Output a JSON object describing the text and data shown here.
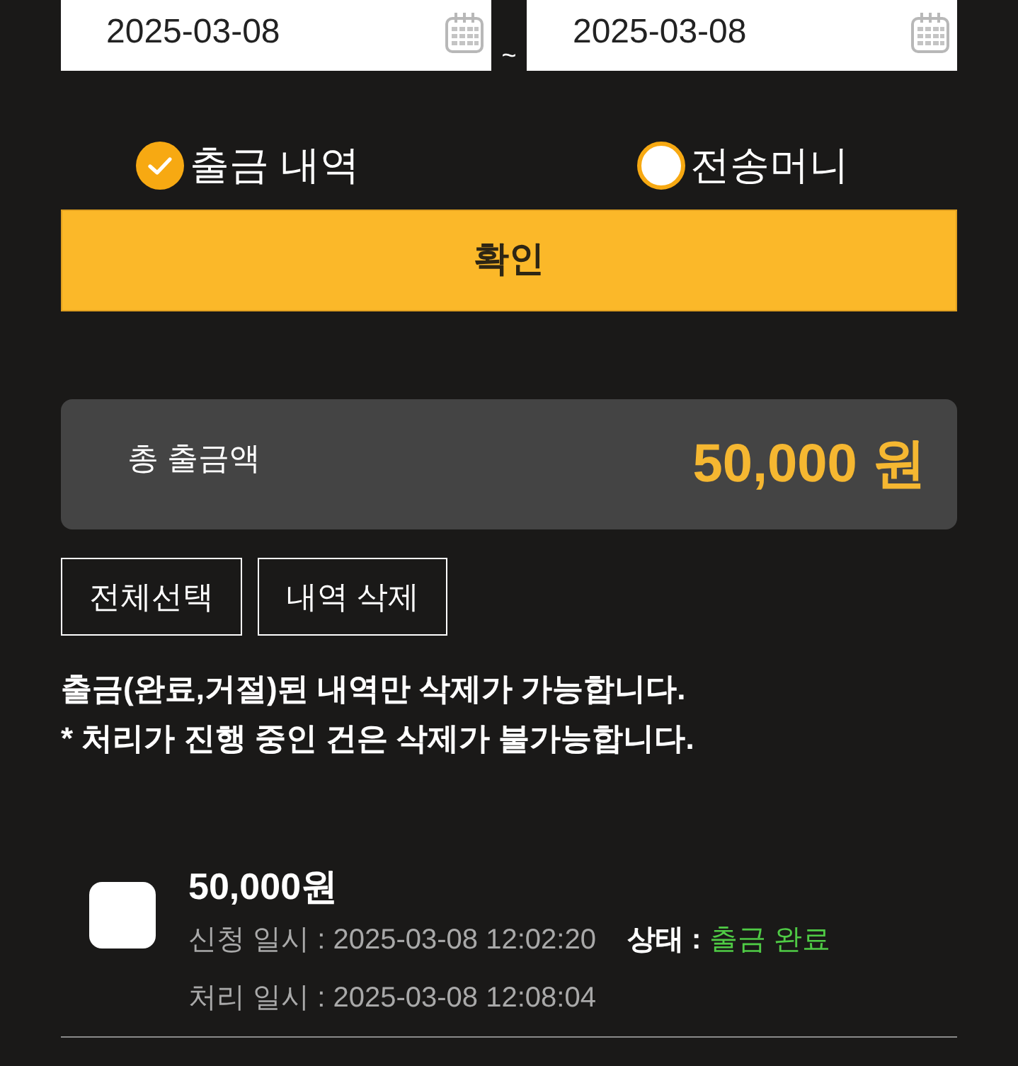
{
  "date_range": {
    "start": {
      "value": "2025-03-08"
    },
    "separator": "~",
    "end": {
      "value": "2025-03-08"
    }
  },
  "type_options": [
    {
      "label": "출금 내역",
      "selected": true
    },
    {
      "label": "전송머니",
      "selected": false
    }
  ],
  "confirm_button": {
    "label": "확인"
  },
  "summary": {
    "label": "총 출금액",
    "amount": "50,000 원"
  },
  "actions": [
    {
      "label": "전체선택"
    },
    {
      "label": "내역 삭제"
    }
  ],
  "notices": [
    "출금(완료,거절)된 내역만 삭제가 가능합니다.",
    "* 처리가 진행 중인 건은 삭제가 불가능합니다."
  ],
  "records": [
    {
      "checked": false,
      "amount": "50,000원",
      "request_label": "신청 일시 :",
      "request_time": "2025-03-08 12:02:20",
      "status_label": "상태 :",
      "status": "출금 완료",
      "color": "#4fcb45",
      "process_label": "처리 일시 :",
      "process_time": "2025-03-08 12:08:04"
    }
  ]
}
